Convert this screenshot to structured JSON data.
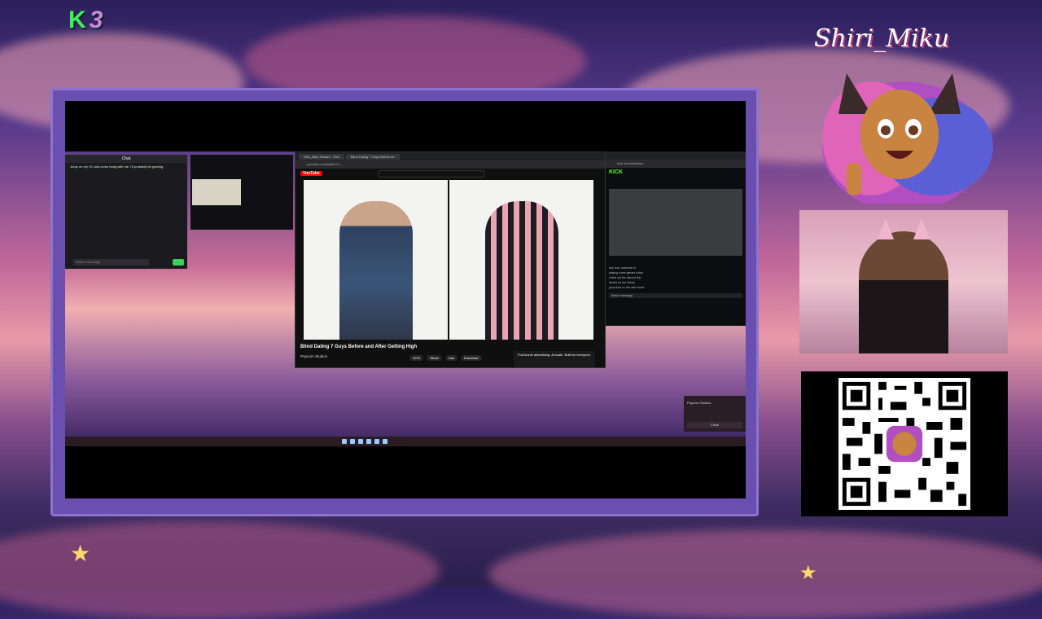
{
  "overlay": {
    "logo_k": "K",
    "logo_number": "3",
    "streamer_name": "Shiri_Miku"
  },
  "chat_window": {
    "header": "Chat",
    "message": "Jump on my VC and come hang with me. I'll probably be gaming.",
    "input_placeholder": "Send a message"
  },
  "browser": {
    "tabs": [
      "Shiri_Miku Stream - Kick",
      "Blind Dating 7 Guys Before an"
    ],
    "address": "youtube.com/watch?v=...",
    "site": "YouTube",
    "search_placeholder": "Search",
    "video_title": "Blind Dating 7 Guys Before and After Getting High",
    "channel": "Popcorn Studios",
    "actions": [
      "107K",
      "Share",
      "Ask",
      "Download"
    ],
    "ad_text": "Full-funnel advertising. At scale. Built for everyone."
  },
  "kick": {
    "address": "kick.com/shirimiku",
    "logo": "KICK",
    "chat_lines": [
      "hey chat, welcome in",
      "playing some games today",
      "check out the discord link",
      "thanks for the follow!",
      "good luck on the next round"
    ],
    "input_placeholder": "Send a message"
  },
  "notification": {
    "title": "Popcorn Studios",
    "close_label": "Close"
  }
}
